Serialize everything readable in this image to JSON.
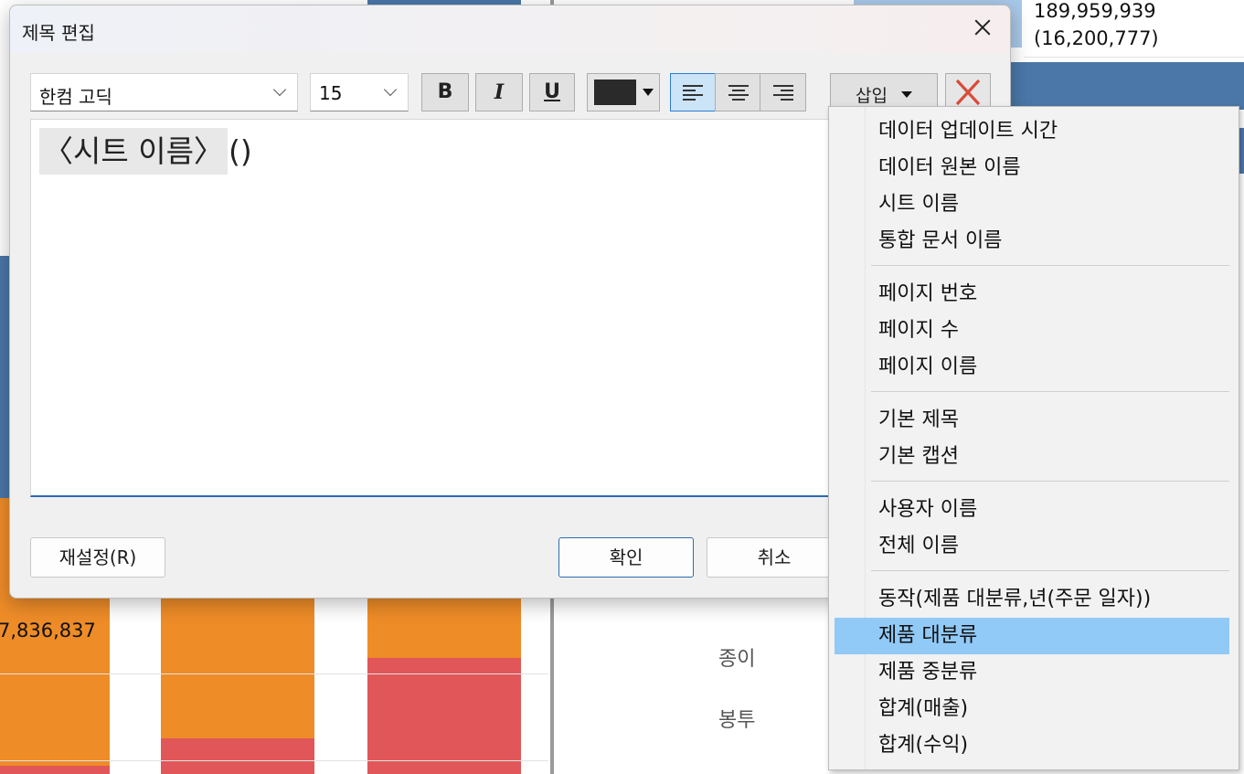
{
  "dialog": {
    "title": "제목 편집",
    "font_family": "한컴 고딕",
    "font_size": "15",
    "bold_label": "B",
    "italic_label": "I",
    "underline_label": "U",
    "text_color": "#2a2a2a",
    "insert_label": "삽입",
    "editor": {
      "token": "〈시트 이름〉",
      "trailing_text": "()"
    },
    "reset_label": "재설정(R)",
    "ok_label": "확인",
    "cancel_label": "취소"
  },
  "insert_menu": {
    "groups": [
      [
        "데이터 업데이트 시간",
        "데이터 원본 이름",
        "시트 이름",
        "통합 문서 이름"
      ],
      [
        "페이지 번호",
        "페이지 수",
        "페이지 이름"
      ],
      [
        "기본 제목",
        "기본 캡션"
      ],
      [
        "사용자 이름",
        "전체 이름"
      ],
      [
        "동작(제품 대분류,년(주문 일자))",
        "제품 대분류",
        "제품 중분류",
        "합계(매출)",
        "합계(수익)"
      ]
    ],
    "highlighted": "제품 대분류",
    "highlight_color": "#91c9f7"
  },
  "background": {
    "value_top": "189,959,939",
    "value_top_paren": "(16,200,777)",
    "value_left": "7,836,837",
    "category_1": "종이",
    "category_2": "봉투",
    "colors": {
      "blue": "#4a77a8",
      "orange": "#ee8c28",
      "red": "#e15759",
      "light_blue": "#a8c8e8"
    }
  }
}
